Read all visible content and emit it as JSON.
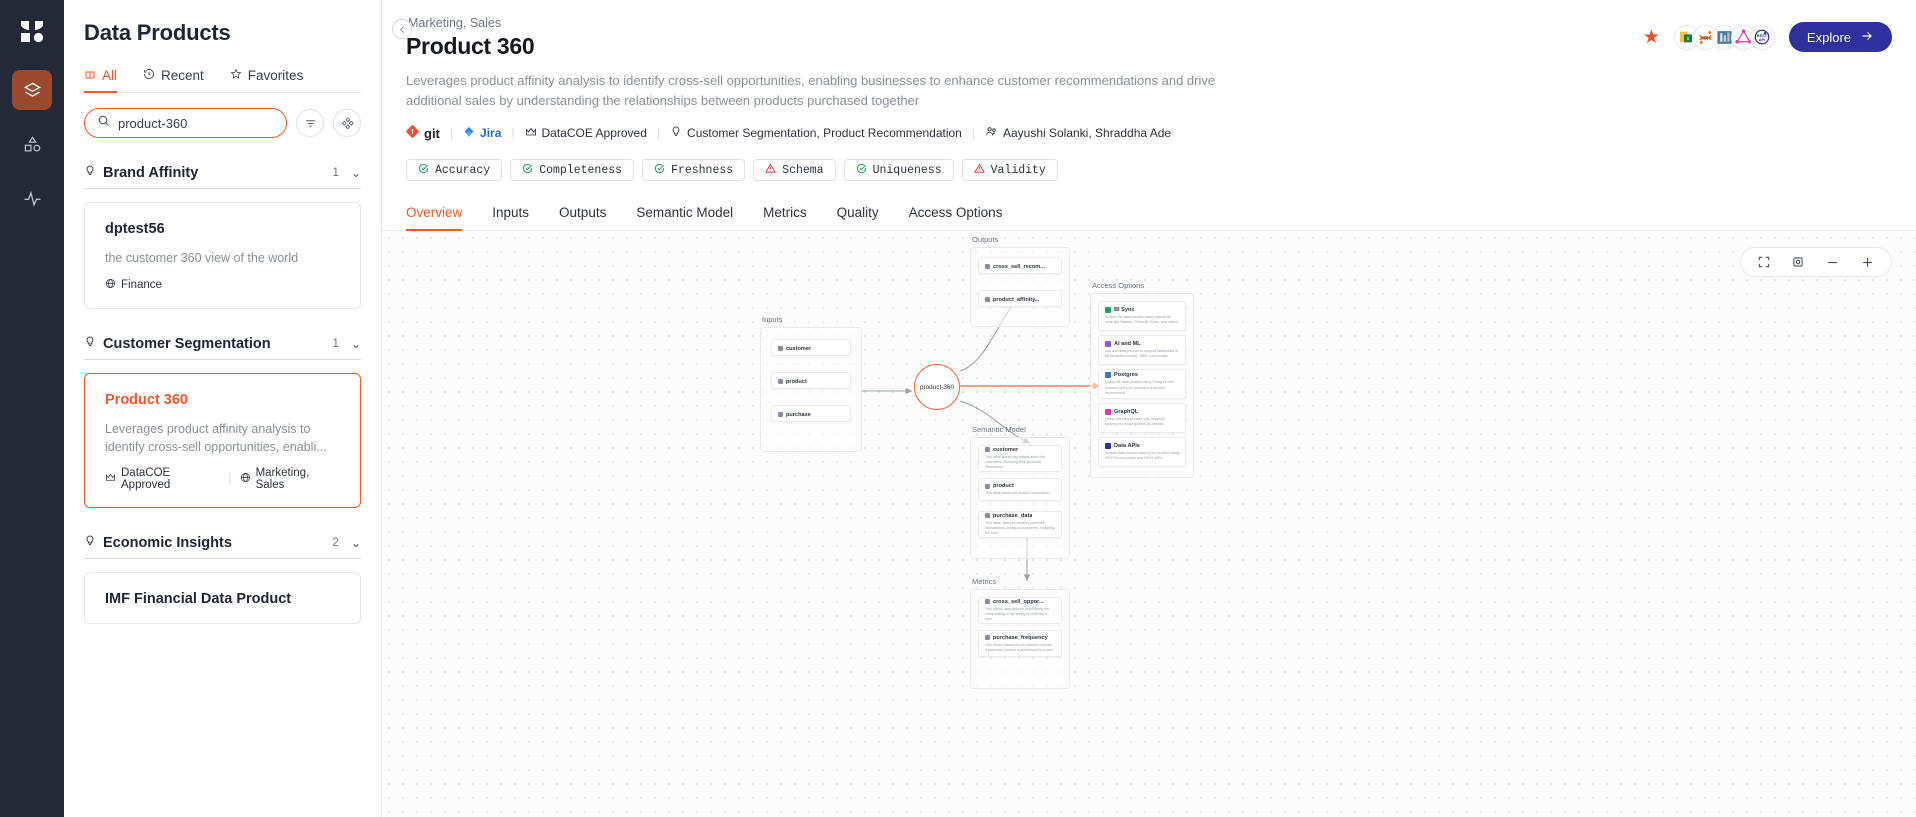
{
  "rail": {
    "logo": "monte-carlo-logo",
    "items": [
      {
        "name": "data-products",
        "icon": "layers-icon",
        "active": true
      },
      {
        "name": "catalog",
        "icon": "shapes-icon",
        "active": false
      },
      {
        "name": "monitors",
        "icon": "pulse-icon",
        "active": false
      }
    ]
  },
  "sidebar": {
    "title": "Data Products",
    "tabs": [
      {
        "label": "All",
        "icon": "box-icon",
        "active": true
      },
      {
        "label": "Recent",
        "icon": "history-icon",
        "active": false
      },
      {
        "label": "Favorites",
        "icon": "star-icon",
        "active": false
      }
    ],
    "search": {
      "value": "product-360",
      "placeholder": "Search"
    },
    "filter_button": "filter-icon",
    "layout_button": "grid-icon",
    "groups": [
      {
        "name": "Brand Affinity",
        "count": "1",
        "cards": [
          {
            "title": "dptest56",
            "desc": "the customer 360 view of the world",
            "meta": [
              {
                "icon": "globe-icon",
                "label": "Finance"
              }
            ],
            "selected": false
          }
        ]
      },
      {
        "name": "Customer Segmentation",
        "count": "1",
        "cards": [
          {
            "title": "Product 360",
            "desc": "Leverages product affinity analysis to identify cross-sell opportunities, enabli...",
            "meta": [
              {
                "icon": "crown-icon",
                "label": "DataCOE Approved"
              },
              {
                "icon": "globe-icon",
                "label": "Marketing, Sales"
              }
            ],
            "selected": true
          }
        ]
      },
      {
        "name": "Economic Insights",
        "count": "2",
        "cards": [
          {
            "title": "IMF Financial Data Product",
            "desc": "",
            "meta": [],
            "selected": false
          }
        ]
      }
    ]
  },
  "header": {
    "back_icon": "chevron-left-icon",
    "breadcrumb": "Marketing, Sales",
    "title": "Product 360",
    "description": "Leverages product affinity analysis to identify cross-sell opportunities, enabling businesses to enhance customer recommendations and drive additional sales by understanding the relationships between products purchased together",
    "favorite_icon": "star-filled-icon",
    "explore_label": "Explore",
    "explore_arrow": "arrow-right-icon",
    "connectors": [
      "excel-icon",
      "jupyter-icon",
      "tableau-icon",
      "graphql-icon",
      "rest-api-icon"
    ],
    "meta": [
      {
        "icon": "git-icon",
        "label": "git"
      },
      {
        "icon": "jira-icon",
        "label": "Jira"
      },
      {
        "icon": "crown-icon",
        "label": "DataCOE Approved"
      },
      {
        "icon": "bulb-icon",
        "label": "Customer Segmentation, Product Recommendation"
      },
      {
        "icon": "users-icon",
        "label": "Aayushi Solanki, Shraddha Ade"
      }
    ],
    "quality_chips": [
      {
        "label": "Accuracy",
        "status": "pass",
        "icon": "check-circle-icon"
      },
      {
        "label": "Completeness",
        "status": "pass",
        "icon": "check-circle-icon"
      },
      {
        "label": "Freshness",
        "status": "pass",
        "icon": "check-circle-icon"
      },
      {
        "label": "Schema",
        "status": "warn",
        "icon": "warning-triangle-icon"
      },
      {
        "label": "Uniqueness",
        "status": "pass",
        "icon": "check-circle-icon"
      },
      {
        "label": "Validity",
        "status": "warn",
        "icon": "warning-triangle-icon"
      }
    ],
    "nav_tabs": [
      {
        "label": "Overview",
        "active": true
      },
      {
        "label": "Inputs",
        "active": false
      },
      {
        "label": "Outputs",
        "active": false
      },
      {
        "label": "Semantic Model",
        "active": false
      },
      {
        "label": "Metrics",
        "active": false
      },
      {
        "label": "Quality",
        "active": false
      },
      {
        "label": "Access Options",
        "active": false
      }
    ]
  },
  "canvas": {
    "zoom_controls": [
      {
        "name": "fullscreen-icon",
        "glyph": "⛶"
      },
      {
        "name": "fit-view-icon",
        "glyph": "◎"
      },
      {
        "name": "zoom-out-icon",
        "glyph": "−"
      },
      {
        "name": "zoom-in-icon",
        "glyph": "+"
      }
    ],
    "center_node": "product-360",
    "groups": [
      {
        "label": "Inputs",
        "nodes": [
          {
            "title": "customer",
            "sub": ""
          },
          {
            "title": "product",
            "sub": ""
          },
          {
            "title": "purchase",
            "sub": ""
          }
        ]
      },
      {
        "label": "Outputs",
        "nodes": [
          {
            "title": "cross_sell_recom...",
            "sub": ""
          },
          {
            "title": "product_affinity...",
            "sub": ""
          }
        ]
      },
      {
        "label": "Semantic Model",
        "nodes": [
          {
            "title": "customer",
            "sub": "This table stores key details about the customers, including their personal information."
          },
          {
            "title": "product",
            "sub": "This table stores the product information."
          },
          {
            "title": "purchase_data",
            "sub": "This table captures detailed purchase transactions, linking to customers, including the time."
          }
        ]
      },
      {
        "label": "Metrics",
        "nodes": [
          {
            "title": "cross_sell_oppor...",
            "sub": "This metric uses data for purchasing the cross-selling or up-selling to potential a user."
          },
          {
            "title": "purchase_frequency",
            "sub": "This metric measures the number of times a particular product is purchased by a user."
          }
        ]
      },
      {
        "label": "Access Options",
        "nodes": [
          {
            "title": "BI Sync",
            "sub": "Access the data product using popular BI tools like Tableau, PowerBI, Excel, and others.",
            "icon_color": "#21a05a"
          },
          {
            "title": "AI and ML",
            "sub": "Use this data product to support Notebooks or ML/Analytics tooling: JDBC conn usage.",
            "icon_color": "#8c5cd6"
          },
          {
            "title": "Postgres",
            "sub": "Query the data product using Postgres wire protocol and your queries in a familiar environment.",
            "icon_color": "#3a76c6"
          },
          {
            "title": "GraphQL",
            "sub": "Query this data product with GraphQL, tailoring the exact queries as needed.",
            "icon_color": "#e535ab"
          },
          {
            "title": "Data APIs",
            "sub": "Access data product data by the product using RESTful end-points and REST APIs.",
            "icon_color": "#2f2f9e"
          }
        ]
      }
    ]
  }
}
